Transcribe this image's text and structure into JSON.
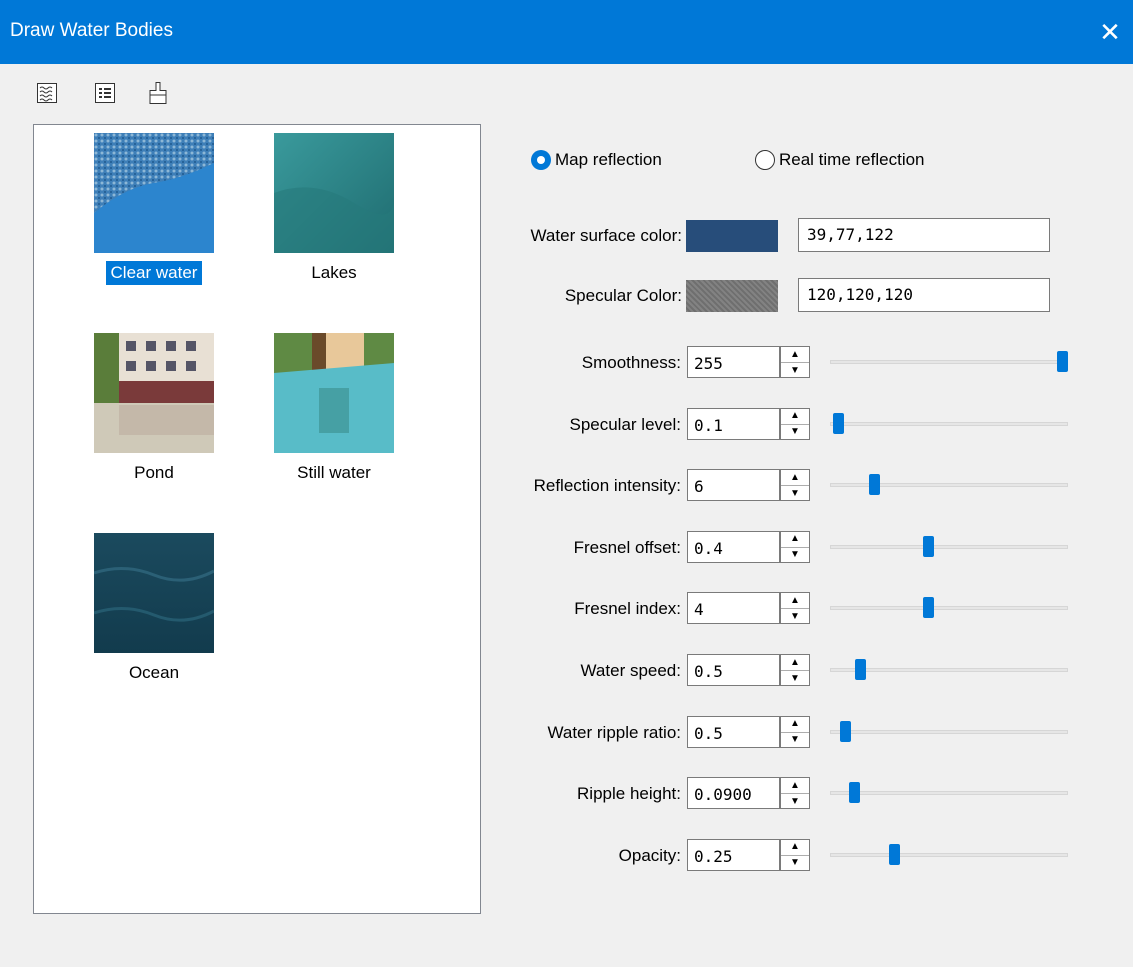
{
  "window": {
    "title": "Draw Water Bodies",
    "close_glyph": "✕"
  },
  "toolbar": [
    {
      "icon": "water-pattern-icon"
    },
    {
      "icon": "properties-list-icon"
    },
    {
      "icon": "paint-brush-icon"
    }
  ],
  "presets": [
    {
      "label": "Clear water",
      "selected": true
    },
    {
      "label": "Lakes",
      "selected": false
    },
    {
      "label": "Pond",
      "selected": false
    },
    {
      "label": "Still water",
      "selected": false
    },
    {
      "label": "Ocean",
      "selected": false
    }
  ],
  "reflection": {
    "map_label": "Map reflection",
    "realtime_label": "Real time reflection",
    "selected": "map"
  },
  "colors": {
    "surface": {
      "label": "Water surface color:",
      "value": "39,77,122",
      "hex": "#274d7a"
    },
    "specular": {
      "label": "Specular Color:",
      "value": "120,120,120",
      "hex": "#787878"
    }
  },
  "params": [
    {
      "label": "Smoothness:",
      "value": "255",
      "level": 1.0
    },
    {
      "label": "Specular level:",
      "value": "0.1",
      "level": 0.0
    },
    {
      "label": "Reflection intensity:",
      "value": "6",
      "level": 0.16
    },
    {
      "label": "Fresnel offset:",
      "value": "0.4",
      "level": 0.4
    },
    {
      "label": "Fresnel index:",
      "value": "4",
      "level": 0.4
    },
    {
      "label": "Water speed:",
      "value": "0.5",
      "level": 0.1
    },
    {
      "label": "Water ripple ratio:",
      "value": "0.5",
      "level": 0.03
    },
    {
      "label": "Ripple height:",
      "value": "0.0900",
      "level": 0.07
    },
    {
      "label": "Opacity:",
      "value": "0.25",
      "level": 0.25
    }
  ]
}
